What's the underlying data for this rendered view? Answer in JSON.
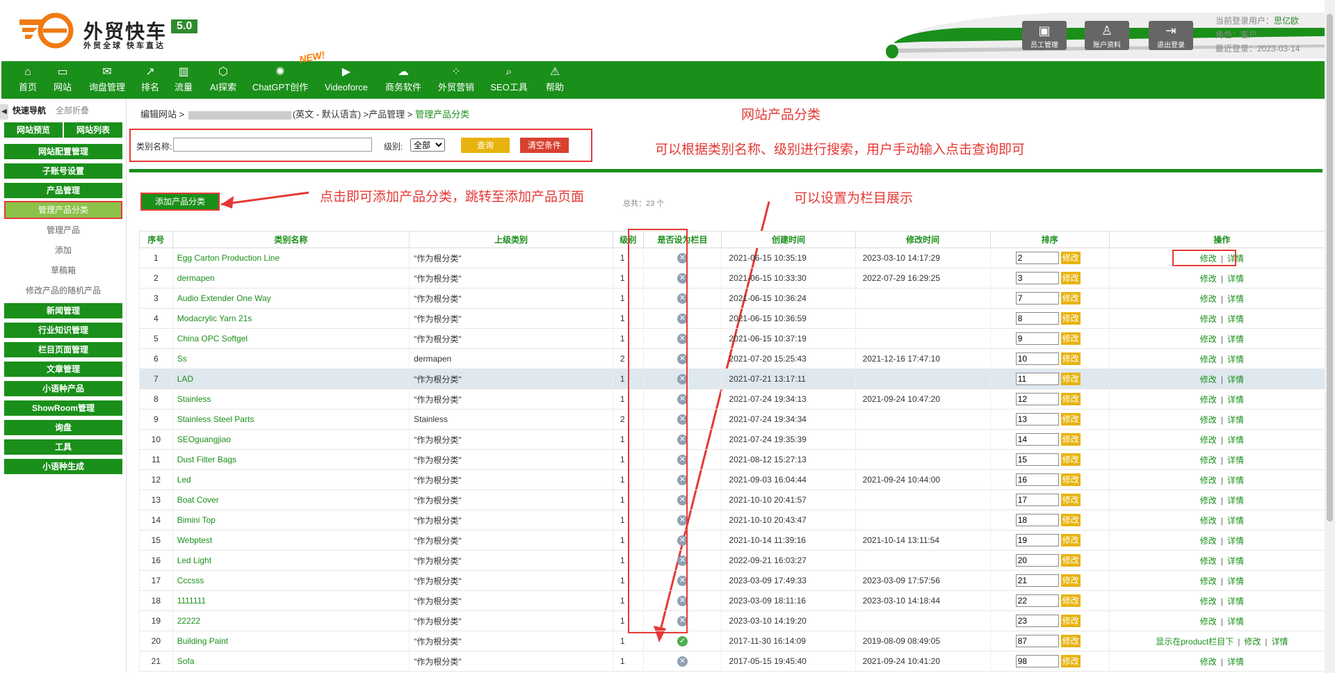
{
  "header": {
    "brand": "外贸快车",
    "version": "5.0",
    "slogan": "外贸全球 快车直达",
    "buttons": [
      {
        "label": "员工管理",
        "icon": "staff-icon"
      },
      {
        "label": "账户资料",
        "icon": "account-icon"
      },
      {
        "label": "退出登录",
        "icon": "logout-icon"
      }
    ],
    "user_label": "当前登录用户：",
    "user_name": "思亿欧",
    "role": "角色：客户",
    "last_login": "最近登录：2023-03-14"
  },
  "nav": [
    {
      "label": "首页",
      "icon": "home-icon"
    },
    {
      "label": "网站",
      "icon": "monitor-icon"
    },
    {
      "label": "询盘管理",
      "icon": "mail-icon"
    },
    {
      "label": "排名",
      "icon": "ranking-icon"
    },
    {
      "label": "流量",
      "icon": "traffic-icon"
    },
    {
      "label": "AI探索",
      "icon": "ai-icon"
    },
    {
      "label": "ChatGPT创作",
      "icon": "chatgpt-icon"
    },
    {
      "label": "Videoforce",
      "icon": "video-icon"
    },
    {
      "label": "商务软件",
      "icon": "software-icon"
    },
    {
      "label": "外贸营销",
      "icon": "marketing-icon"
    },
    {
      "label": "SEO工具",
      "icon": "seo-search-icon"
    },
    {
      "label": "帮助",
      "icon": "help-icon"
    }
  ],
  "new_badge": "NEW!",
  "sidebar": {
    "quick_nav": "快速导航",
    "collapse_all": "全部折叠",
    "preview": "网站预览",
    "site_list": "网站列表",
    "items": [
      {
        "label": "网站配置管理",
        "type": "section"
      },
      {
        "label": "子账号设置",
        "type": "section"
      },
      {
        "label": "产品管理",
        "type": "section"
      },
      {
        "label": "管理产品分类",
        "type": "active"
      },
      {
        "label": "管理产品",
        "type": "sub"
      },
      {
        "label": "添加",
        "type": "sub"
      },
      {
        "label": "草稿箱",
        "type": "sub"
      },
      {
        "label": "修改产品的随机产品",
        "type": "sub"
      },
      {
        "label": "新闻管理",
        "type": "section"
      },
      {
        "label": "行业知识管理",
        "type": "section"
      },
      {
        "label": "栏目页面管理",
        "type": "section"
      },
      {
        "label": "文章管理",
        "type": "section"
      },
      {
        "label": "小语种产品",
        "type": "section"
      },
      {
        "label": "ShowRoom管理",
        "type": "section"
      },
      {
        "label": "询盘",
        "type": "section"
      },
      {
        "label": "工具",
        "type": "section"
      },
      {
        "label": "小语种生成",
        "type": "section"
      }
    ]
  },
  "breadcrumb": {
    "edit_site": "编辑网站 >",
    "lang": "(英文 - 默认语言) >产品管理 >",
    "current": "管理产品分类"
  },
  "search": {
    "name_label": "类别名称:",
    "name_value": "",
    "level_label": "级别:",
    "level_value": "全部",
    "query_btn": "查询",
    "clear_btn": "清空条件"
  },
  "add_button": "添加产品分类",
  "total": "总共：23 个",
  "annotations": {
    "title": "网站产品分类",
    "search_note": "可以根据类别名称、级别进行搜索，用户手动输入点击查询即可",
    "add_note": "点击即可添加产品分类，跳转至添加产品页面",
    "column_note": "可以设置为栏目展示"
  },
  "table": {
    "headers": [
      "序号",
      "类别名称",
      "上级类别",
      "级别",
      "是否设为栏目",
      "创建时间",
      "修改时间",
      "排序",
      "操作"
    ],
    "sort_btn": "修改",
    "op_edit": "修改",
    "op_detail": "详情",
    "op_sep": "|",
    "rows": [
      {
        "no": "1",
        "name": "Egg Carton Production Line",
        "parent": "\"作为根分类\"",
        "level": "1",
        "column": false,
        "created": "2021-06-15 10:35:19",
        "modified": "2023-03-10 14:17:29",
        "sort": "2",
        "show": ""
      },
      {
        "no": "2",
        "name": "dermapen",
        "parent": "\"作为根分类\"",
        "level": "1",
        "column": false,
        "created": "2021-06-15 10:33:30",
        "modified": "2022-07-29 16:29:25",
        "sort": "3",
        "show": ""
      },
      {
        "no": "3",
        "name": "Audio Extender One Way",
        "parent": "\"作为根分类\"",
        "level": "1",
        "column": false,
        "created": "2021-06-15 10:36:24",
        "modified": "",
        "sort": "7",
        "show": ""
      },
      {
        "no": "4",
        "name": "Modacrylic Yarn 21s",
        "parent": "\"作为根分类\"",
        "level": "1",
        "column": false,
        "created": "2021-06-15 10:36:59",
        "modified": "",
        "sort": "8",
        "show": ""
      },
      {
        "no": "5",
        "name": "China OPC Softgel",
        "parent": "\"作为根分类\"",
        "level": "1",
        "column": false,
        "created": "2021-06-15 10:37:19",
        "modified": "",
        "sort": "9",
        "show": ""
      },
      {
        "no": "6",
        "name": "Ss",
        "parent": "dermapen",
        "level": "2",
        "column": false,
        "created": "2021-07-20 15:25:43",
        "modified": "2021-12-16 17:47:10",
        "sort": "10",
        "show": ""
      },
      {
        "no": "7",
        "name": "LAD",
        "parent": "\"作为根分类\"",
        "level": "1",
        "column": false,
        "created": "2021-07-21 13:17:11",
        "modified": "",
        "sort": "11",
        "show": ""
      },
      {
        "no": "8",
        "name": "Stainless",
        "parent": "\"作为根分类\"",
        "level": "1",
        "column": false,
        "created": "2021-07-24 19:34:13",
        "modified": "2021-09-24 10:47:20",
        "sort": "12",
        "show": ""
      },
      {
        "no": "9",
        "name": "Stainless Steel Parts",
        "parent": "Stainless",
        "level": "2",
        "column": false,
        "created": "2021-07-24 19:34:34",
        "modified": "",
        "sort": "13",
        "show": ""
      },
      {
        "no": "10",
        "name": "SEOguangjiao",
        "parent": "\"作为根分类\"",
        "level": "1",
        "column": false,
        "created": "2021-07-24 19:35:39",
        "modified": "",
        "sort": "14",
        "show": ""
      },
      {
        "no": "11",
        "name": "Dust Filter Bags",
        "parent": "\"作为根分类\"",
        "level": "1",
        "column": false,
        "created": "2021-08-12 15:27:13",
        "modified": "",
        "sort": "15",
        "show": ""
      },
      {
        "no": "12",
        "name": "Led",
        "parent": "\"作为根分类\"",
        "level": "1",
        "column": false,
        "created": "2021-09-03 16:04:44",
        "modified": "2021-09-24 10:44:00",
        "sort": "16",
        "show": ""
      },
      {
        "no": "13",
        "name": "Boat Cover",
        "parent": "\"作为根分类\"",
        "level": "1",
        "column": false,
        "created": "2021-10-10 20:41:57",
        "modified": "",
        "sort": "17",
        "show": ""
      },
      {
        "no": "14",
        "name": "Bimini Top",
        "parent": "\"作为根分类\"",
        "level": "1",
        "column": false,
        "created": "2021-10-10 20:43:47",
        "modified": "",
        "sort": "18",
        "show": ""
      },
      {
        "no": "15",
        "name": "Webptest",
        "parent": "\"作为根分类\"",
        "level": "1",
        "column": false,
        "created": "2021-10-14 11:39:16",
        "modified": "2021-10-14 13:11:54",
        "sort": "19",
        "show": ""
      },
      {
        "no": "16",
        "name": "Led Light",
        "parent": "\"作为根分类\"",
        "level": "1",
        "column": false,
        "created": "2022-09-21 16:03:27",
        "modified": "",
        "sort": "20",
        "show": ""
      },
      {
        "no": "17",
        "name": "Cccsss",
        "parent": "\"作为根分类\"",
        "level": "1",
        "column": false,
        "created": "2023-03-09 17:49:33",
        "modified": "2023-03-09 17:57:56",
        "sort": "21",
        "show": ""
      },
      {
        "no": "18",
        "name": "1111111",
        "parent": "\"作为根分类\"",
        "level": "1",
        "column": false,
        "created": "2023-03-09 18:11:16",
        "modified": "2023-03-10 14:18:44",
        "sort": "22",
        "show": ""
      },
      {
        "no": "19",
        "name": "22222",
        "parent": "\"作为根分类\"",
        "level": "1",
        "column": false,
        "created": "2023-03-10 14:19:20",
        "modified": "",
        "sort": "23",
        "show": ""
      },
      {
        "no": "20",
        "name": "Building Paint",
        "parent": "\"作为根分类\"",
        "level": "1",
        "column": true,
        "created": "2017-11-30 16:14:09",
        "modified": "2019-08-09 08:49:05",
        "sort": "87",
        "show": "显示在product栏目下"
      },
      {
        "no": "21",
        "name": "Sofa",
        "parent": "\"作为根分类\"",
        "level": "1",
        "column": false,
        "created": "2017-05-15 19:45:40",
        "modified": "2021-09-24 10:41:20",
        "sort": "98",
        "show": ""
      }
    ]
  },
  "colors": {
    "brand_green": "#1a8f1a",
    "accent_red": "#e53935",
    "button_yellow": "#e8b30f"
  }
}
